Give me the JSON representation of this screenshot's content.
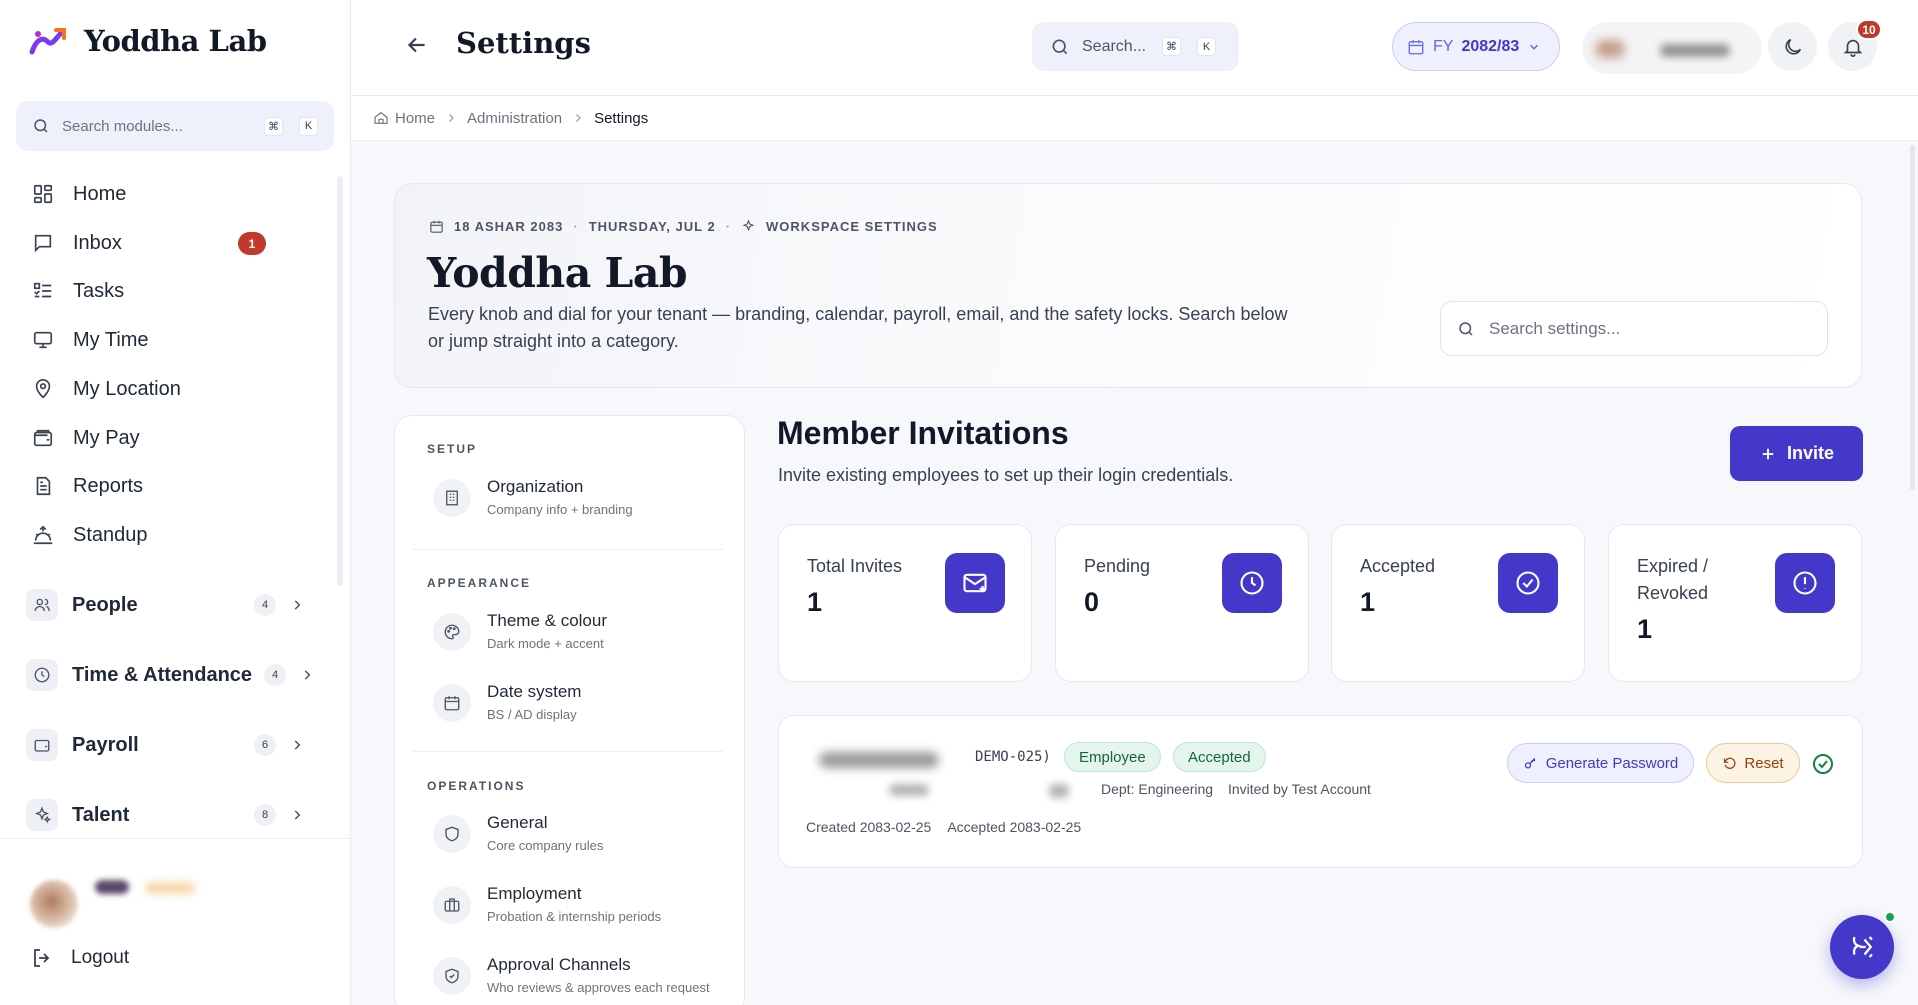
{
  "sidebar": {
    "brand": "Yoddha Lab",
    "search_placeholder": "Search modules...",
    "kbd_cmd": "⌘",
    "kbd_key": "K",
    "items": [
      {
        "label": "Home",
        "icon": "grid-icon"
      },
      {
        "label": "Inbox",
        "icon": "message-icon",
        "badge": "1"
      },
      {
        "label": "Tasks",
        "icon": "list-check-icon"
      },
      {
        "label": "My Time",
        "icon": "monitor-icon"
      },
      {
        "label": "My Location",
        "icon": "map-pin-icon"
      },
      {
        "label": "My Pay",
        "icon": "wallet-icon"
      },
      {
        "label": "Reports",
        "icon": "document-icon"
      },
      {
        "label": "Standup",
        "icon": "sunrise-icon"
      }
    ],
    "groups": [
      {
        "label": "People",
        "count": "4",
        "icon": "users-icon"
      },
      {
        "label": "Time & Attendance",
        "count": "4",
        "icon": "clock-icon"
      },
      {
        "label": "Payroll",
        "count": "6",
        "icon": "wallet-icon"
      },
      {
        "label": "Talent",
        "count": "8",
        "icon": "sparkles-icon"
      }
    ],
    "logout": "Logout"
  },
  "topbar": {
    "title": "Settings",
    "search_placeholder": "Search...",
    "kbd_cmd": "⌘",
    "kbd_key": "K",
    "fy_label": "FY",
    "fy_value": "2082/83",
    "notification_count": "10"
  },
  "breadcrumb": [
    "Home",
    "Administration",
    "Settings"
  ],
  "hero": {
    "date_bs": "18 ASHAR 2083",
    "date_ad": "THURSDAY, JUL 2",
    "section": "WORKSPACE SETTINGS",
    "title": "Yoddha Lab",
    "description": "Every knob and dial for your tenant — branding, calendar, payroll, email, and the safety locks. Search below or jump straight into a category.",
    "search_placeholder": "Search settings..."
  },
  "categories": {
    "setup_heading": "SETUP",
    "appearance_heading": "APPEARANCE",
    "operations_heading": "OPERATIONS",
    "items": [
      {
        "title": "Organization",
        "subtitle": "Company info + branding",
        "icon": "building-icon"
      },
      {
        "title": "Theme & colour",
        "subtitle": "Dark mode + accent",
        "icon": "palette-icon"
      },
      {
        "title": "Date system",
        "subtitle": "BS / AD display",
        "icon": "calendar-icon"
      },
      {
        "title": "General",
        "subtitle": "Core company rules",
        "icon": "shield-icon"
      },
      {
        "title": "Employment",
        "subtitle": "Probation & internship periods",
        "icon": "briefcase-icon"
      },
      {
        "title": "Approval Channels",
        "subtitle": "Who reviews & approves each request",
        "icon": "shield-check-icon"
      }
    ]
  },
  "invitations": {
    "title": "Member Invitations",
    "subtitle": "Invite existing employees to set up their login credentials.",
    "invite_button": "Invite",
    "stats": [
      {
        "label": "Total Invites",
        "value": "1",
        "icon": "mail-icon"
      },
      {
        "label": "Pending",
        "value": "0",
        "icon": "clock-icon"
      },
      {
        "label": "Accepted",
        "value": "1",
        "icon": "check-circle-icon"
      },
      {
        "label": "Expired / Revoked",
        "value": "1",
        "icon": "alert-circle-icon"
      }
    ],
    "row": {
      "code": "DEMO-025)",
      "role": "Employee",
      "status": "Accepted",
      "department": "Dept: Engineering",
      "invited_by": "Invited by Test Account",
      "created": "Created 2083-02-25",
      "accepted": "Accepted 2083-02-25",
      "generate_password": "Generate Password",
      "reset": "Reset"
    }
  },
  "colors": {
    "accent": "#4338ca",
    "badge_red": "#c0392b",
    "success": "#15803d"
  }
}
